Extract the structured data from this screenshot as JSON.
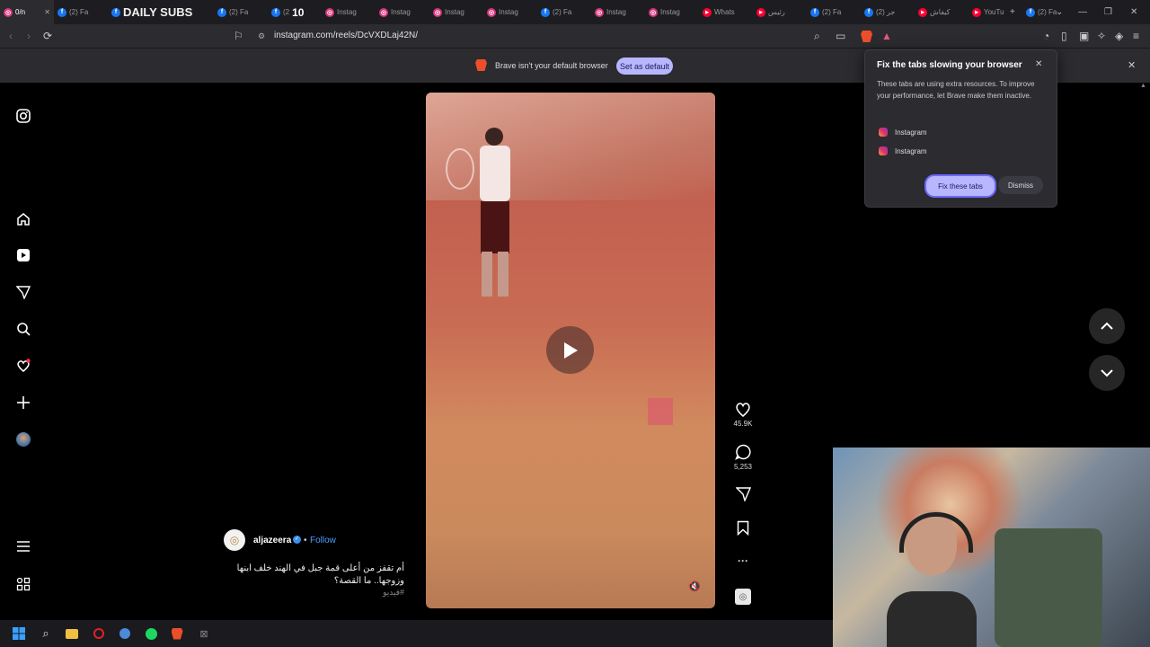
{
  "browser": {
    "tabs": [
      {
        "label": "0/n",
        "icon": "instagram-icon",
        "active": true
      },
      {
        "label": "(2) Fa",
        "icon": "facebook-icon"
      },
      {
        "label": "DAILY SUBS",
        "icon": "facebook-icon",
        "big": true
      },
      {
        "label": "(2) Fa",
        "icon": "facebook-icon"
      },
      {
        "label": "(2",
        "icon": "facebook-icon",
        "extra": "10"
      },
      {
        "label": "Instag",
        "icon": "instagram-icon"
      },
      {
        "label": "Instag",
        "icon": "instagram-icon"
      },
      {
        "label": "Instag",
        "icon": "instagram-icon"
      },
      {
        "label": "Instag",
        "icon": "instagram-icon"
      },
      {
        "label": "(2) Fa",
        "icon": "facebook-icon"
      },
      {
        "label": "Instag",
        "icon": "instagram-icon"
      },
      {
        "label": "Instag",
        "icon": "instagram-icon"
      },
      {
        "label": "Whats",
        "icon": "youtube-icon"
      },
      {
        "label": "رئيس",
        "icon": "youtube-icon"
      },
      {
        "label": "(2) Fa",
        "icon": "facebook-icon"
      },
      {
        "label": "(2) جر",
        "icon": "facebook-icon"
      },
      {
        "label": "كيفاش",
        "icon": "youtube-icon"
      },
      {
        "label": "YouTu",
        "icon": "youtube-icon"
      },
      {
        "label": "(2) Fa",
        "icon": "facebook-icon"
      }
    ],
    "url": "instagram.com/reels/DcVXDLaj42N/"
  },
  "default_bar": {
    "message": "Brave isn't your default browser",
    "button": "Set as default"
  },
  "popup": {
    "title": "Fix the tabs slowing your browser",
    "body": "These tabs are using extra resources. To improve your performance, let Brave make them inactive.",
    "items": [
      "Instagram",
      "Instagram"
    ],
    "fix_button": "Fix these tabs",
    "dismiss_button": "Dismiss"
  },
  "reel": {
    "username": "aljazeera",
    "follow": "Follow",
    "caption": "أم تقفز من أعلى قمة جبل في الهند خلف ابنها وزوجها.. ما القصة؟",
    "hashtag": "#فيديو",
    "likes": "45.9K",
    "comments": "5,253"
  },
  "colors": {
    "accent": "#b8b6ff",
    "brave": "#ea4f2a",
    "link": "#4a9eff"
  }
}
